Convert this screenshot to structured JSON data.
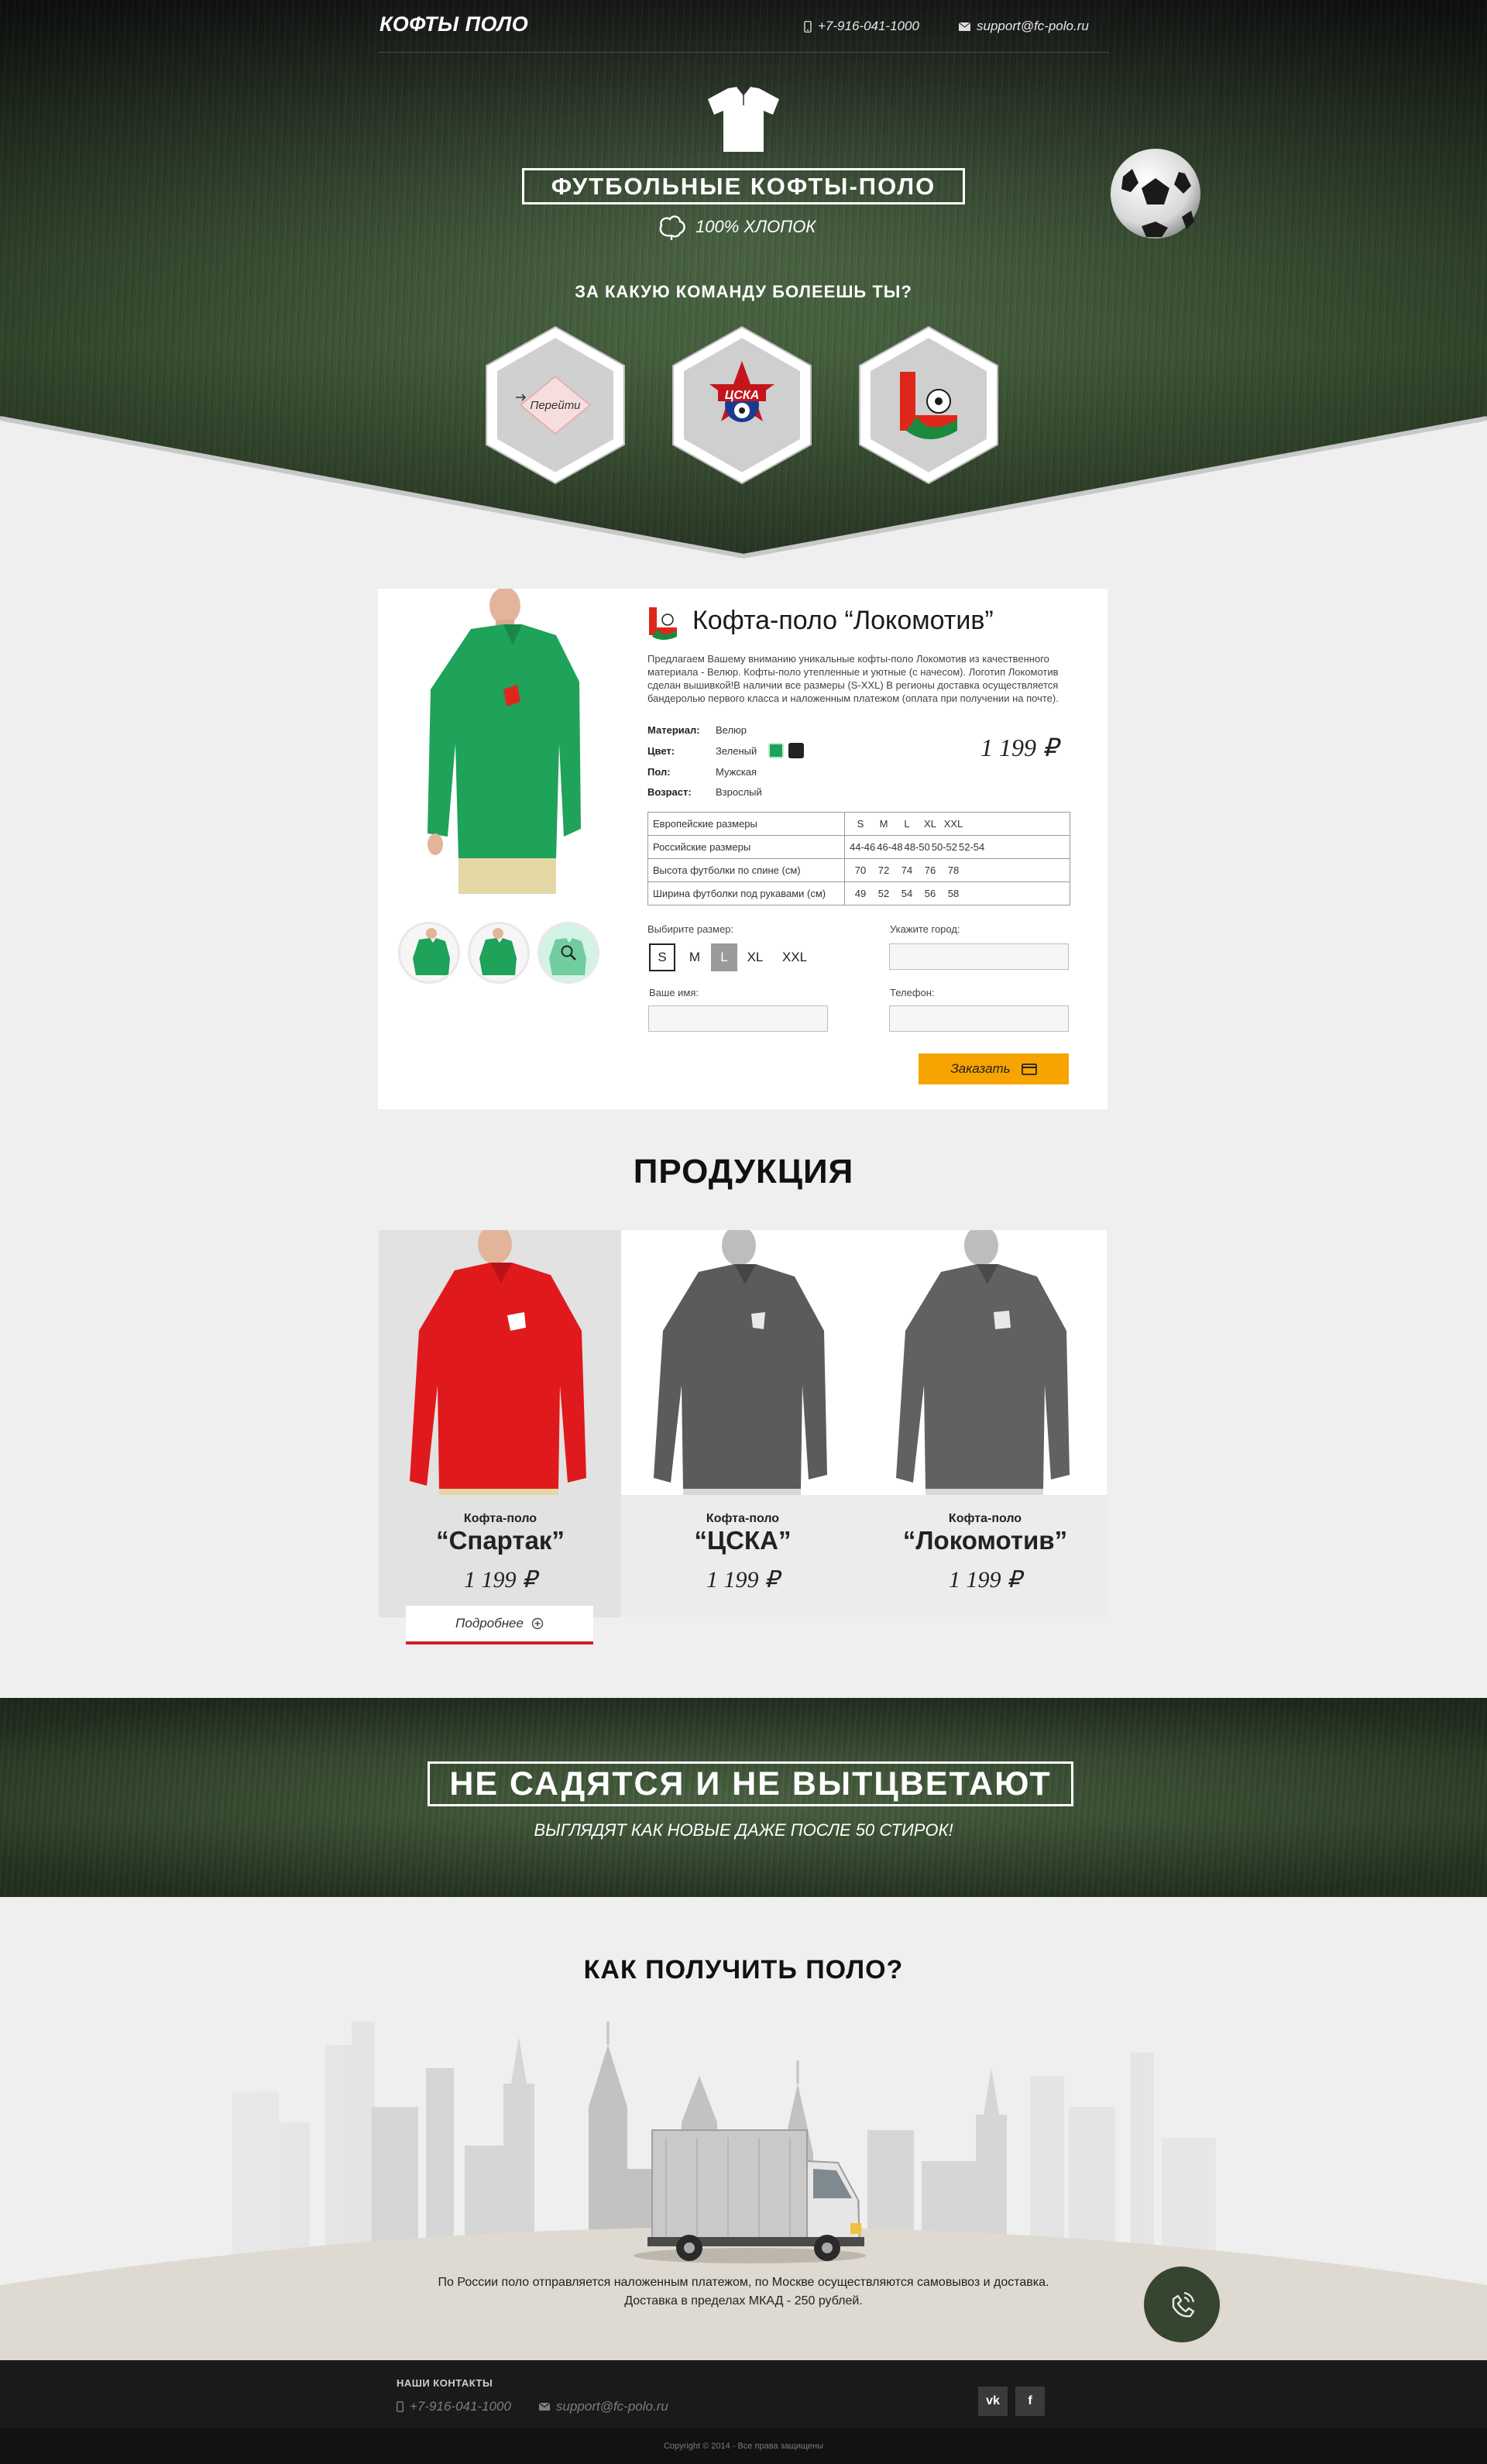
{
  "header": {
    "logo": "КОФТЫ ПОЛО",
    "phone": "+7-916-041-1000",
    "email": "support@fc-polo.ru"
  },
  "hero": {
    "title": "ФУТБОЛЬНЫЕ КОФТЫ-ПОЛО",
    "cotton": "100% ХЛОПОК",
    "team_question": "ЗА КАКУЮ КОМАНДУ БОЛЕЕШЬ ТЫ?",
    "teams": [
      {
        "name": "spartak",
        "button": "Перейти"
      },
      {
        "name": "cska",
        "logo_text": "ЦСКА"
      },
      {
        "name": "lokomotiv"
      }
    ]
  },
  "product": {
    "title": "Кофта-поло “Локомотив”",
    "description": "Предлагаем Вашему вниманию уникальные кофты-поло Локомотив из качественного материала - Велюр. Кофты-поло утепленные и уютные (с начесом). Логотип Локомотив сделан вышивкой!В наличии все размеры (S-XXL) В регионы доставка осуществляется бандеролью первого класса и наложенным платежом (оплата при получении на почте).",
    "specs": [
      {
        "label": "Материал:",
        "value": "Велюр"
      },
      {
        "label": "Цвет:",
        "value": "Зеленый"
      },
      {
        "label": "Пол:",
        "value": "Мужская"
      },
      {
        "label": "Возраст:",
        "value": "Взрослый"
      }
    ],
    "colors": [
      "#1aa35a",
      "#222222"
    ],
    "price": "1 199 ₽",
    "size_table": [
      {
        "label": "Европейские размеры",
        "values": [
          "S",
          "M",
          "L",
          "XL",
          "XXL"
        ]
      },
      {
        "label": "Российские размеры",
        "values": [
          "44-46",
          "46-48",
          "48-50",
          "50-52",
          "52-54"
        ]
      },
      {
        "label": "Высота футболки по спине (см)",
        "values": [
          "70",
          "72",
          "74",
          "76",
          "78"
        ]
      },
      {
        "label": "Ширина футболки под рукавами (см)",
        "values": [
          "49",
          "52",
          "54",
          "56",
          "58"
        ]
      }
    ],
    "form": {
      "size_label": "Выбирите размер:",
      "sizes": [
        "S",
        "M",
        "L",
        "XL",
        "XXL"
      ],
      "city_label": "Укажите город:",
      "name_label": "Ваше имя:",
      "phone_label": "Телефон:",
      "order_button": "Заказать"
    }
  },
  "products": {
    "title": "ПРОДУКЦИЯ",
    "items": [
      {
        "kind": "Кофта-поло",
        "name": "“Спартак”",
        "price": "1 199 ₽"
      },
      {
        "kind": "Кофта-поло",
        "name": "“ЦСКА”",
        "price": "1 199 ₽"
      },
      {
        "kind": "Кофта-поло",
        "name": "“Локомотив”",
        "price": "1 199 ₽"
      }
    ],
    "more_button": "Подробнее"
  },
  "banner": {
    "title": "НЕ САДЯТСЯ И НЕ ВЫТЦВЕТАЮТ",
    "subtitle": "ВЫГЛЯДЯТ КАК НОВЫЕ ДАЖЕ ПОСЛЕ 50 СТИРОК!"
  },
  "delivery": {
    "title": "КАК ПОЛУЧИТЬ ПОЛО?",
    "line1": "По России поло отправляется наложенным платежом, по Москве осуществляются самовывоз и доставка.",
    "line2": "Доставка в пределах МКАД - 250 рублей."
  },
  "footer": {
    "contacts_title": "НАШИ КОНТАКТЫ",
    "phone": "+7-916-041-1000",
    "email": "support@fc-polo.ru",
    "social": [
      "vk",
      "f"
    ],
    "copyright": "Copyright © 2014 - Все права защищены"
  }
}
